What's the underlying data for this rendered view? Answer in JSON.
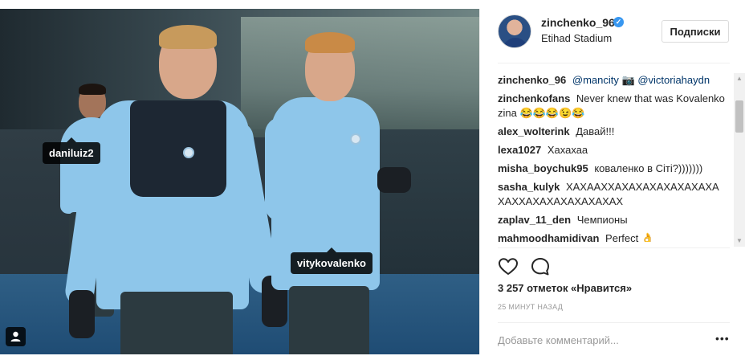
{
  "photo": {
    "tags": [
      "daniluiz2",
      "vitykovalenko"
    ],
    "tag_button_icon": "user-tag-icon"
  },
  "post": {
    "username": "zinchenko_96",
    "verified_icon": "verified-badge-icon",
    "location": "Etihad Stadium",
    "follow_label": "Подписки"
  },
  "comments": [
    {
      "user": "zinchenko_96",
      "parts": [
        "@mancity",
        " 📷 ",
        "@victoriahaydn"
      ]
    },
    {
      "user": "zinchenkofans",
      "text": "Never knew that was Kovalenko zina 😂😂😂😉😂"
    },
    {
      "user": "alex_wolterink",
      "text": "Давай!!!"
    },
    {
      "user": "lexa1027",
      "text": "Хахахаа"
    },
    {
      "user": "misha_boychuk95",
      "text": "коваленко в Сіті?)))))))"
    },
    {
      "user": "sasha_kulyk",
      "text": "ХАХААХХАХАХАХАХАХАХАХА ХАХХАХАХАХАХАХАХАХ"
    },
    {
      "user": "zaplav_11_den",
      "text": "Чемпионы"
    },
    {
      "user": "mahmoodhamidiyan",
      "text": "Perfect 👌"
    }
  ],
  "actions": {
    "like_icon": "heart-icon",
    "comment_icon": "comment-bubble-icon",
    "likes_text": "3 257 отметок «Нравится»",
    "time_ago": "25 МИНУТ НАЗАД"
  },
  "comment_box": {
    "placeholder": "Добавьте комментарий...",
    "more_label": "•••"
  },
  "colors": {
    "mention": "#003569",
    "verified": "#3897f0",
    "text": "#262626",
    "muted": "#999999"
  }
}
